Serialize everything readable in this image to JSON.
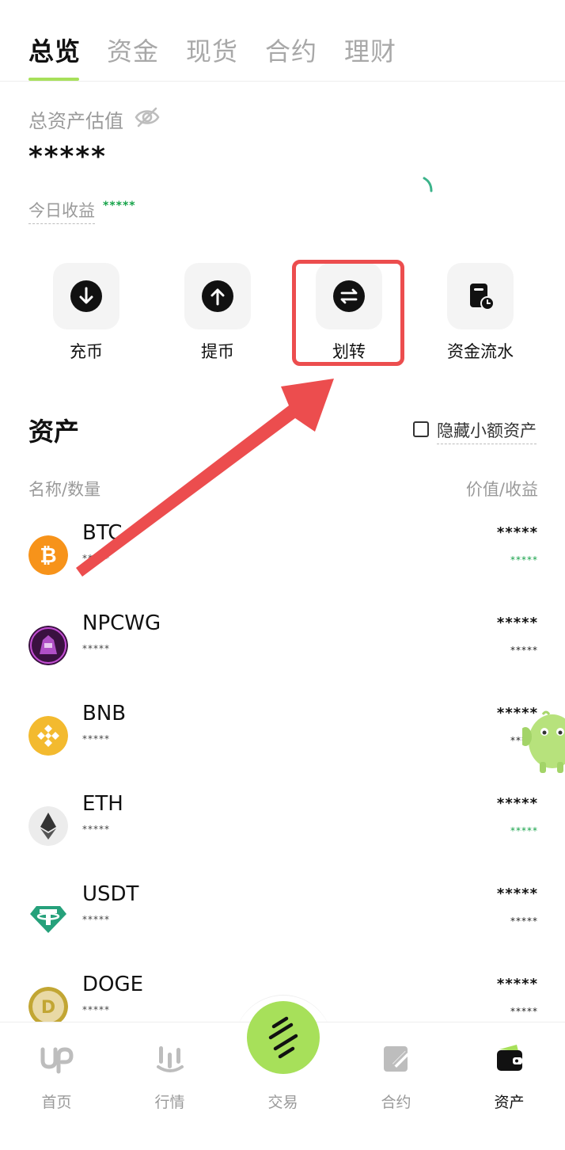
{
  "tabs": [
    {
      "label": "总览",
      "active": true
    },
    {
      "label": "资金",
      "active": false
    },
    {
      "label": "现货",
      "active": false
    },
    {
      "label": "合约",
      "active": false
    },
    {
      "label": "理财",
      "active": false
    }
  ],
  "overview": {
    "total_label": "总资产估值",
    "total_value": "*****",
    "today_label": "今日收益",
    "today_value": "*****"
  },
  "actions": [
    {
      "label": "充币",
      "icon": "arrow-down-icon"
    },
    {
      "label": "提币",
      "icon": "arrow-up-icon"
    },
    {
      "label": "划转",
      "icon": "transfer-icon"
    },
    {
      "label": "资金流水",
      "icon": "ledger-icon"
    }
  ],
  "assets": {
    "title": "资产",
    "hide_small_label": "隐藏小额资产",
    "hide_small_checked": false,
    "col_left": "名称/数量",
    "col_right": "价值/收益",
    "rows": [
      {
        "name": "BTC",
        "qty": "*****",
        "value": "*****",
        "pnl": "*****",
        "pnl_green": true,
        "icon": "btc-icon"
      },
      {
        "name": "NPCWG",
        "qty": "*****",
        "value": "*****",
        "pnl": "*****",
        "pnl_green": false,
        "icon": "npcwg-icon"
      },
      {
        "name": "BNB",
        "qty": "*****",
        "value": "*****",
        "pnl": "*****",
        "pnl_green": false,
        "icon": "bnb-icon"
      },
      {
        "name": "ETH",
        "qty": "*****",
        "value": "*****",
        "pnl": "*****",
        "pnl_green": true,
        "icon": "eth-icon"
      },
      {
        "name": "USDT",
        "qty": "*****",
        "value": "*****",
        "pnl": "*****",
        "pnl_green": false,
        "icon": "usdt-icon"
      },
      {
        "name": "DOGE",
        "qty": "*****",
        "value": "*****",
        "pnl": "*****",
        "pnl_green": false,
        "icon": "doge-icon"
      }
    ]
  },
  "nav": [
    {
      "label": "首页",
      "icon": "home-logo-icon",
      "active": false
    },
    {
      "label": "行情",
      "icon": "market-icon",
      "active": false
    },
    {
      "label": "交易",
      "icon": "trade-icon",
      "active": false
    },
    {
      "label": "合约",
      "icon": "contract-icon",
      "active": false
    },
    {
      "label": "资产",
      "icon": "wallet-icon",
      "active": true
    }
  ],
  "colors": {
    "accent": "#a7e05a",
    "annotation_red": "#ec4d4e",
    "positive": "#17a34a"
  }
}
